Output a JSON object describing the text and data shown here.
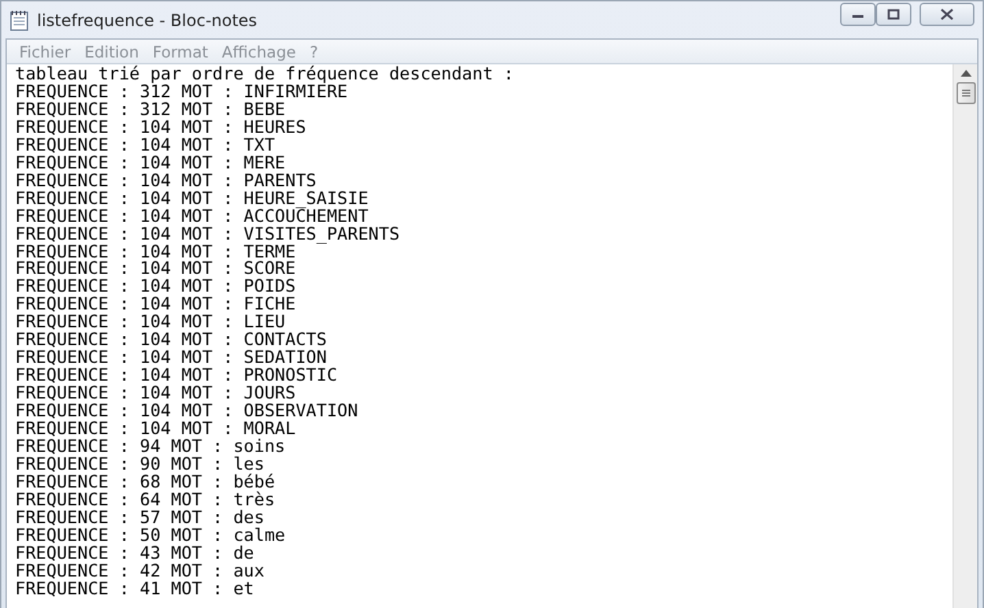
{
  "window": {
    "title": "listefrequence - Bloc-notes"
  },
  "menu": [
    "Fichier",
    "Edition",
    "Format",
    "Affichage",
    "?"
  ],
  "document": {
    "lines": [
      "tableau trié par ordre de fréquence descendant :",
      "FREQUENCE : 312 MOT : INFIRMIERE",
      "FREQUENCE : 312 MOT : BEBE",
      "FREQUENCE : 104 MOT : HEURES",
      "FREQUENCE : 104 MOT : TXT",
      "FREQUENCE : 104 MOT : MERE",
      "FREQUENCE : 104 MOT : PARENTS",
      "FREQUENCE : 104 MOT : HEURE_SAISIE",
      "FREQUENCE : 104 MOT : ACCOUCHEMENT",
      "FREQUENCE : 104 MOT : VISITES_PARENTS",
      "FREQUENCE : 104 MOT : TERME",
      "FREQUENCE : 104 MOT : SCORE",
      "FREQUENCE : 104 MOT : POIDS",
      "FREQUENCE : 104 MOT : FICHE",
      "FREQUENCE : 104 MOT : LIEU",
      "FREQUENCE : 104 MOT : CONTACTS",
      "FREQUENCE : 104 MOT : SEDATION",
      "FREQUENCE : 104 MOT : PRONOSTIC",
      "FREQUENCE : 104 MOT : JOURS",
      "FREQUENCE : 104 MOT : OBSERVATION",
      "FREQUENCE : 104 MOT : MORAL",
      "FREQUENCE : 94 MOT : soins",
      "FREQUENCE : 90 MOT : les",
      "FREQUENCE : 68 MOT : bébé",
      "FREQUENCE : 64 MOT : très",
      "FREQUENCE : 57 MOT : des",
      "FREQUENCE : 50 MOT : calme",
      "FREQUENCE : 43 MOT : de",
      "FREQUENCE : 42 MOT : aux",
      "FREQUENCE : 41 MOT : et"
    ]
  }
}
